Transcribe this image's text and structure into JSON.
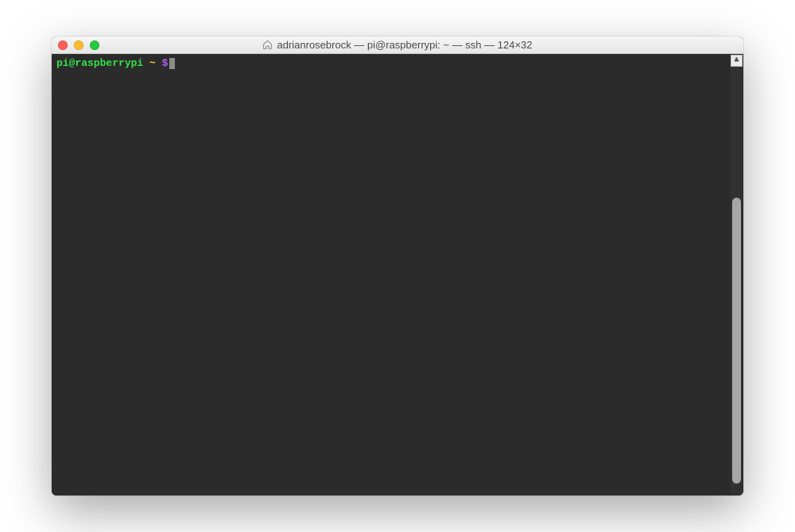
{
  "window": {
    "title": "adrianrosebrock — pi@raspberrypi: ~ — ssh — 124×32"
  },
  "colors": {
    "terminal_bg": "#2b2b2b",
    "userhost_fg": "#34e14b",
    "path_fg": "#f6c945",
    "sigil_fg": "#b061ff"
  },
  "prompt": {
    "userhost": "pi@raspberrypi",
    "path": "~",
    "sigil": "$",
    "input": ""
  }
}
